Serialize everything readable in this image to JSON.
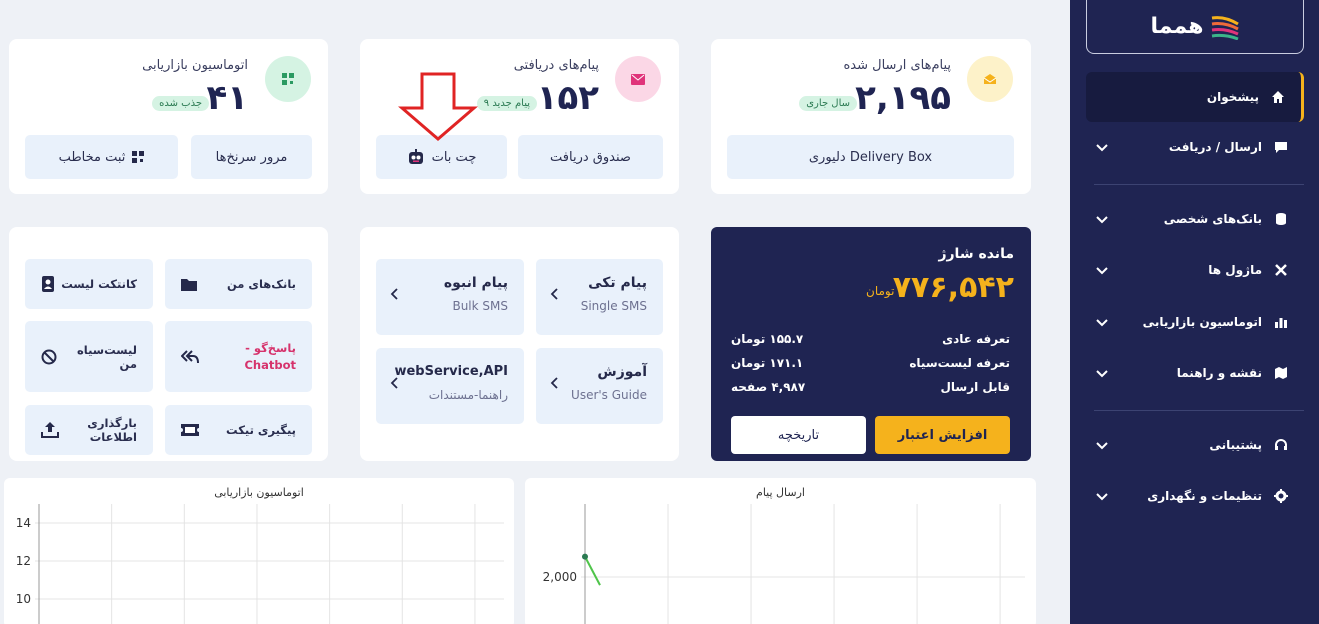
{
  "sidebar": {
    "logo_text": "همما",
    "items": [
      {
        "label": "پیشخوان",
        "icon": "home-icon",
        "active": true
      },
      {
        "label": "ارسال / دریافت",
        "icon": "message-icon"
      },
      {
        "label": "بانک‌های شخصی",
        "icon": "database-icon"
      },
      {
        "label": "ماژول ها",
        "icon": "tools-icon"
      },
      {
        "label": "اتوماسیون بازاریابی",
        "icon": "bar-chart-icon"
      },
      {
        "label": "نقشه و راهنما",
        "icon": "map-icon"
      },
      {
        "label": "پشتیبانی",
        "icon": "headset-icon"
      },
      {
        "label": "تنظیمات و نگهداری",
        "icon": "gear-icon"
      }
    ]
  },
  "sent_card": {
    "title": "پیام‌های ارسال شده",
    "value": "۲,۱۹۵",
    "badge": "سال جاری",
    "button": "دلیوری Delivery Box",
    "icon": "envelope-open-icon",
    "icon_bg": "#fdf2c9",
    "icon_color": "#f5b21c"
  },
  "received_card": {
    "title": "پیام‌های دریافتی",
    "value": "۱۵۲",
    "badge": "۹ پیام جدید",
    "button_inbox": "صندوق دریافت",
    "button_chatbot": "چت بات",
    "icon": "envelope-icon",
    "icon_bg": "#fbd7e6",
    "icon_color": "#e0337a"
  },
  "marketing_card": {
    "title": "اتوماسیون بازاریابی",
    "value": "۴۱",
    "badge": "جذب شده",
    "button_funnel": "مرور سرنخ‌ها",
    "button_register": "ثبت مخاطب",
    "icon": "qr-icon",
    "icon_bg": "#d5f3e3",
    "icon_color": "#2b9a62"
  },
  "balance_card": {
    "title": "مانده شارژ",
    "amount": "۷۷۶,۵۴۲",
    "currency": "تومان",
    "rows": [
      {
        "label": "تعرفه عادی",
        "value": "۱۵۵.۷ تومان"
      },
      {
        "label": "تعرفه لیست‌سیاه",
        "value": "۱۷۱.۱ تومان"
      },
      {
        "label": "قابل ارسال",
        "value": "۴,۹۸۷ صفحه"
      }
    ],
    "increase_button": "افزایش اعتبار",
    "history_button": "تاریخچه"
  },
  "links": [
    {
      "title": "پیام تکی",
      "sub": "Single SMS"
    },
    {
      "title": "پیام انبوه",
      "sub": "Bulk SMS"
    },
    {
      "title": "آموزش",
      "sub": "User's Guide"
    },
    {
      "title": "webService,API",
      "sub": "راهنما-مستندات"
    }
  ],
  "quick": [
    {
      "label": "بانک‌های من",
      "icon": "folder-icon"
    },
    {
      "label": "کانتکت لیست",
      "icon": "contact-book-icon"
    },
    {
      "label": "پاسخ‌گو - Chatbot",
      "icon": "reply-all-icon",
      "color": "#d6336c"
    },
    {
      "label": "لیست‌سیاه من",
      "icon": "ban-icon"
    },
    {
      "label": "پیگیری تیکت",
      "icon": "ticket-icon"
    },
    {
      "label": "بارگذاری اطلاعات",
      "icon": "upload-icon"
    }
  ],
  "chart_data": [
    {
      "type": "line",
      "title": "اتوماسیون بازاریابی",
      "y_ticks": [
        "14",
        "12",
        "10"
      ],
      "grid": true
    },
    {
      "type": "line",
      "title": "ارسال پیام",
      "y_ticks": [
        "2,000"
      ],
      "grid": true,
      "series": [
        {
          "values": [
            2250,
            1900
          ]
        }
      ]
    }
  ]
}
